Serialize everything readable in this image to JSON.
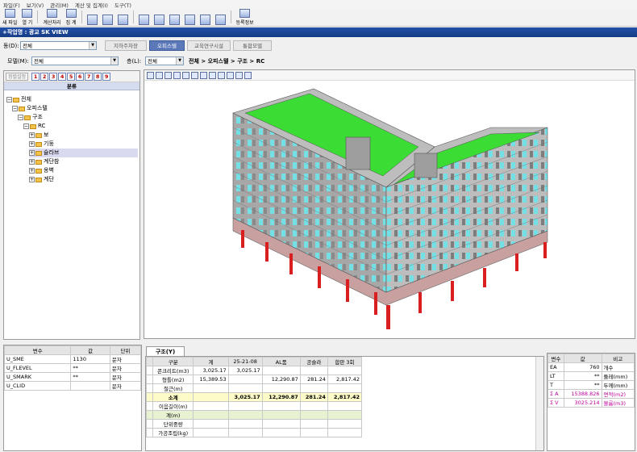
{
  "menu": [
    "파일(F)",
    "보기(V)",
    "관리(M)",
    "계산 및 집계(I)",
    "도구(T)"
  ],
  "toolbar": {
    "buttons": [
      "새 파일",
      "열 기",
      "계산처리",
      "집 계",
      "",
      "",
      "",
      "",
      "",
      "",
      "",
      "",
      "",
      "",
      "등록정보"
    ]
  },
  "titlebar": "+작업명 : 광교 SK VIEW",
  "filters": {
    "dong_label": "동(D):",
    "dong_value": "전체",
    "model_label": "모델(M):",
    "model_value": "전체",
    "floor_label": "층(L):",
    "floor_value": "전체",
    "breadcrumb": "전체 > 오피스텔 > 구조 > RC"
  },
  "tabs": [
    "지하주차장",
    "오피스텔",
    "교육연구시설",
    "통합모델"
  ],
  "tree": {
    "sort_label": "정렬설정",
    "levels": [
      "1",
      "2",
      "3",
      "4",
      "5",
      "6",
      "7",
      "8",
      "9"
    ],
    "header": "분류",
    "nodes": [
      "전체",
      "오피스텔",
      "구조",
      "RC",
      "보",
      "기둥",
      "슬라브",
      "계단참",
      "옹벽",
      "계단"
    ]
  },
  "props_left": {
    "headers": [
      "변수",
      "값",
      "단위"
    ],
    "rows": [
      [
        "U_SME",
        "1130",
        "문자"
      ],
      [
        "U_FLEVEL",
        "**",
        "문자"
      ],
      [
        "U_SMARK",
        "**",
        "문자"
      ],
      [
        "U_CLID",
        "",
        "문자"
      ]
    ]
  },
  "bottom": {
    "tab": "구조(Y)",
    "headers": [
      "구분",
      "계",
      "25-21-08",
      "AL품",
      "공슬라",
      "합판 3회"
    ],
    "rows": [
      [
        "콘크리트(m3)",
        "3,025.17",
        "3,025.17",
        "",
        "",
        ""
      ],
      [
        "형틀(m2)",
        "15,389.53",
        "",
        "12,290.87",
        "281.24",
        "2,817.42"
      ],
      [
        "철근(m)",
        "",
        "",
        "",
        "",
        ""
      ],
      [
        "소계",
        "",
        "3,025.17",
        "12,290.87",
        "281.24",
        "2,817.42"
      ],
      [
        "이음길이(m)",
        "",
        "",
        "",
        "",
        ""
      ],
      [
        "계(m)",
        "",
        "",
        "",
        "",
        ""
      ],
      [
        "단위중량",
        "",
        "",
        "",
        "",
        ""
      ],
      [
        "가공조립(kg)",
        "",
        "",
        "",
        "",
        ""
      ]
    ]
  },
  "props_right": {
    "headers": [
      "변수",
      "값",
      "비고"
    ],
    "rows": [
      [
        "EA",
        "760",
        "개수"
      ],
      [
        "LT",
        "**",
        "둘레(mm)"
      ],
      [
        "T",
        "**",
        "두께(mm)"
      ],
      [
        "Σ A",
        "15388.826",
        "면적(m2)"
      ],
      [
        "Σ V",
        "3025.214",
        "볼륨(m3)"
      ]
    ]
  },
  "colors": {
    "accent": "#2350a8",
    "slab": "#3bdc34",
    "window": "#73e0e6",
    "column": "#d81e1e"
  }
}
